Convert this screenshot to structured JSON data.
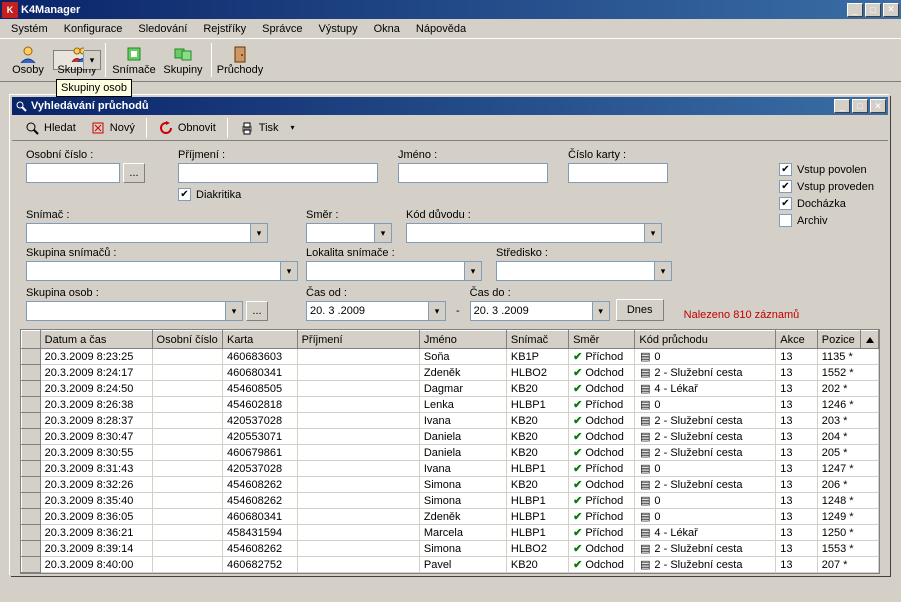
{
  "app": {
    "title": "K4Manager"
  },
  "menu": [
    "Systém",
    "Konfigurace",
    "Sledování",
    "Rejstříky",
    "Správce",
    "Výstupy",
    "Okna",
    "Nápověda"
  ],
  "toolbar": [
    {
      "label": "Osoby",
      "icon": "person-icon"
    },
    {
      "label": "Skupiny",
      "icon": "group-icon",
      "selected": true
    },
    {
      "label": "Snímače",
      "icon": "reader-icon"
    },
    {
      "label": "Skupiny",
      "icon": "readers-group-icon"
    },
    {
      "label": "Průchody",
      "icon": "door-icon"
    }
  ],
  "tooltip": "Skupiny osob",
  "child": {
    "title": "Vyhledávání průchodů",
    "buttons": {
      "search": "Hledat",
      "new": "Nový",
      "refresh": "Obnovit",
      "print": "Tisk"
    },
    "labels": {
      "osobni_cislo": "Osobní číslo :",
      "prijmeni": "Příjmení :",
      "jmeno": "Jméno :",
      "cislo_karty": "Číslo karty :",
      "diakritika": "Diakritika",
      "snimac": "Snímač :",
      "smer": "Směr :",
      "kod_duvodu": "Kód důvodu :",
      "skupina_snimacu": "Skupina snímačů :",
      "lokalita": "Lokalita snímače :",
      "stredisko": "Středisko :",
      "skupina_osob": "Skupina osob :",
      "cas_od": "Čas od :",
      "cas_do": "Čas do :",
      "dnes": "Dnes"
    },
    "checks": {
      "vstup_povolen": "Vstup povolen",
      "vstup_proveden": "Vstup proveden",
      "dochazka": "Docházka",
      "archiv": "Archiv"
    },
    "date_from": "20. 3 .2009",
    "date_to": "20. 3 .2009",
    "found": "Nalezeno 810 záznamů"
  },
  "grid": {
    "headers": [
      "Datum a čas",
      "Osobní číslo",
      "Karta",
      "Příjmení",
      "Jméno",
      "Snímač",
      "Směr",
      "Kód průchodu",
      "Akce",
      "Pozice"
    ],
    "rows": [
      {
        "dt": "20.3.2009 8:23:25",
        "oc": "",
        "karta": "460683603",
        "prij": "",
        "jm": "Soňa",
        "sn": "KB1P",
        "smer": "Příchod",
        "kod": "0",
        "akce": "13",
        "poz": "1135 *"
      },
      {
        "dt": "20.3.2009 8:24:17",
        "oc": "",
        "karta": "460680341",
        "prij": "",
        "jm": "Zdeněk",
        "sn": "HLBO2",
        "smer": "Odchod",
        "kod": "2 - Služební cesta",
        "akce": "13",
        "poz": "1552 *"
      },
      {
        "dt": "20.3.2009 8:24:50",
        "oc": "",
        "karta": "454608505",
        "prij": "",
        "jm": "Dagmar",
        "sn": "KB20",
        "smer": "Odchod",
        "kod": "4 - Lékař",
        "akce": "13",
        "poz": "202 *"
      },
      {
        "dt": "20.3.2009 8:26:38",
        "oc": "",
        "karta": "454602818",
        "prij": "",
        "jm": "Lenka",
        "sn": "HLBP1",
        "smer": "Příchod",
        "kod": "0",
        "akce": "13",
        "poz": "1246 *"
      },
      {
        "dt": "20.3.2009 8:28:37",
        "oc": "",
        "karta": "420537028",
        "prij": "",
        "jm": "Ivana",
        "sn": "KB20",
        "smer": "Odchod",
        "kod": "2 - Služební cesta",
        "akce": "13",
        "poz": "203 *"
      },
      {
        "dt": "20.3.2009 8:30:47",
        "oc": "",
        "karta": "420553071",
        "prij": "",
        "jm": "Daniela",
        "sn": "KB20",
        "smer": "Odchod",
        "kod": "2 - Služební cesta",
        "akce": "13",
        "poz": "204 *"
      },
      {
        "dt": "20.3.2009 8:30:55",
        "oc": "",
        "karta": "460679861",
        "prij": "",
        "jm": "Daniela",
        "sn": "KB20",
        "smer": "Odchod",
        "kod": "2 - Služební cesta",
        "akce": "13",
        "poz": "205 *"
      },
      {
        "dt": "20.3.2009 8:31:43",
        "oc": "",
        "karta": "420537028",
        "prij": "",
        "jm": "Ivana",
        "sn": "HLBP1",
        "smer": "Příchod",
        "kod": "0",
        "akce": "13",
        "poz": "1247 *"
      },
      {
        "dt": "20.3.2009 8:32:26",
        "oc": "",
        "karta": "454608262",
        "prij": "",
        "jm": "Simona",
        "sn": "KB20",
        "smer": "Odchod",
        "kod": "2 - Služební cesta",
        "akce": "13",
        "poz": "206 *"
      },
      {
        "dt": "20.3.2009 8:35:40",
        "oc": "",
        "karta": "454608262",
        "prij": "",
        "jm": "Simona",
        "sn": "HLBP1",
        "smer": "Příchod",
        "kod": "0",
        "akce": "13",
        "poz": "1248 *"
      },
      {
        "dt": "20.3.2009 8:36:05",
        "oc": "",
        "karta": "460680341",
        "prij": "",
        "jm": "Zdeněk",
        "sn": "HLBP1",
        "smer": "Příchod",
        "kod": "0",
        "akce": "13",
        "poz": "1249 *"
      },
      {
        "dt": "20.3.2009 8:36:21",
        "oc": "",
        "karta": "458431594",
        "prij": "",
        "jm": "Marcela",
        "sn": "HLBP1",
        "smer": "Příchod",
        "kod": "4 - Lékař",
        "akce": "13",
        "poz": "1250 *"
      },
      {
        "dt": "20.3.2009 8:39:14",
        "oc": "",
        "karta": "454608262",
        "prij": "",
        "jm": "Simona",
        "sn": "HLBO2",
        "smer": "Odchod",
        "kod": "2 - Služební cesta",
        "akce": "13",
        "poz": "1553 *"
      },
      {
        "dt": "20.3.2009 8:40:00",
        "oc": "",
        "karta": "460682752",
        "prij": "",
        "jm": "Pavel",
        "sn": "KB20",
        "smer": "Odchod",
        "kod": "2 - Služební cesta",
        "akce": "13",
        "poz": "207 *"
      }
    ]
  }
}
